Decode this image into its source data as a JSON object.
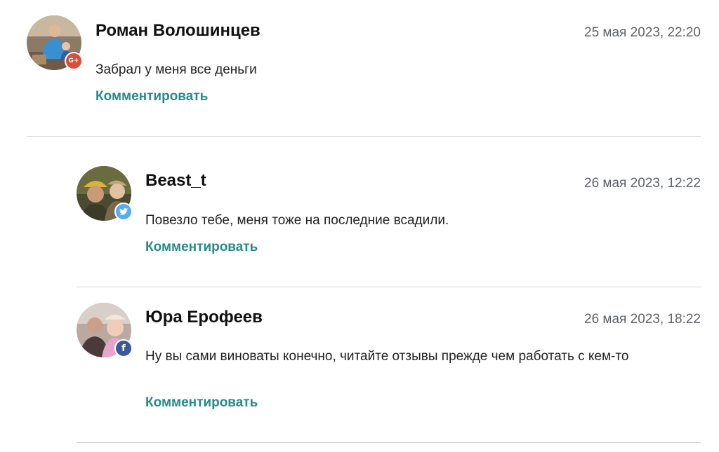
{
  "colors": {
    "link": "#268a8a",
    "date": "#5f6368",
    "divider": "#d6d6d6",
    "gplus_badge": "#dd4b39",
    "twitter_badge": "#55acee",
    "facebook_badge": "#3b5998"
  },
  "comments": [
    {
      "author": "Роман Волошинцев",
      "date": "25 мая 2023, 22:20",
      "text": "Забрал у меня все деньги",
      "reply_label": "Комментировать",
      "avatar_badge": "google-plus-icon",
      "badge_glyph": "G+",
      "reply_level": 0
    },
    {
      "author": "Beast_t",
      "date": "26 мая 2023, 12:22",
      "text": "Повезло тебе, меня тоже на последние всадили.",
      "reply_label": "Комментировать",
      "avatar_badge": "twitter-icon",
      "reply_level": 1
    },
    {
      "author": "Юра Ерофеев",
      "date": "26 мая 2023, 18:22",
      "text": "Ну вы сами виноваты конечно, читайте отзывы прежде чем работать с кем-то",
      "reply_label": "Комментировать",
      "avatar_badge": "facebook-icon",
      "badge_glyph": "f",
      "reply_level": 1
    }
  ]
}
